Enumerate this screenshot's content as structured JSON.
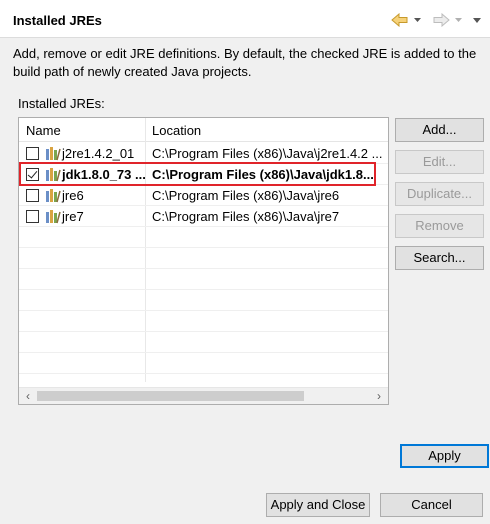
{
  "header": {
    "title": "Installed JREs"
  },
  "description": "Add, remove or edit JRE definitions. By default, the checked JRE is added to the build path of newly created Java projects.",
  "table": {
    "label": "Installed JREs:",
    "columns": {
      "name": "Name",
      "location": "Location"
    },
    "rows": [
      {
        "name": "j2re1.4.2_01",
        "location": "C:\\Program Files (x86)\\Java\\j2re1.4.2 ...",
        "checked": false,
        "bold": false
      },
      {
        "name": "jdk1.8.0_73 ...",
        "location": "C:\\Program Files (x86)\\Java\\jdk1.8...",
        "checked": true,
        "bold": true
      },
      {
        "name": "jre6",
        "location": "C:\\Program Files (x86)\\Java\\jre6",
        "checked": false,
        "bold": false
      },
      {
        "name": "jre7",
        "location": "C:\\Program Files (x86)\\Java\\jre7",
        "checked": false,
        "bold": false
      }
    ]
  },
  "buttons": {
    "add": "Add...",
    "edit": "Edit...",
    "duplicate": "Duplicate...",
    "remove": "Remove",
    "search": "Search...",
    "apply": "Apply",
    "apply_close": "Apply and Close",
    "cancel": "Cancel"
  },
  "icons": {
    "back": "back-arrow-icon",
    "forward": "forward-arrow-icon",
    "jre": "jre-library-icon"
  },
  "colors": {
    "highlight": "#e0242a",
    "focus": "#0078d7"
  }
}
